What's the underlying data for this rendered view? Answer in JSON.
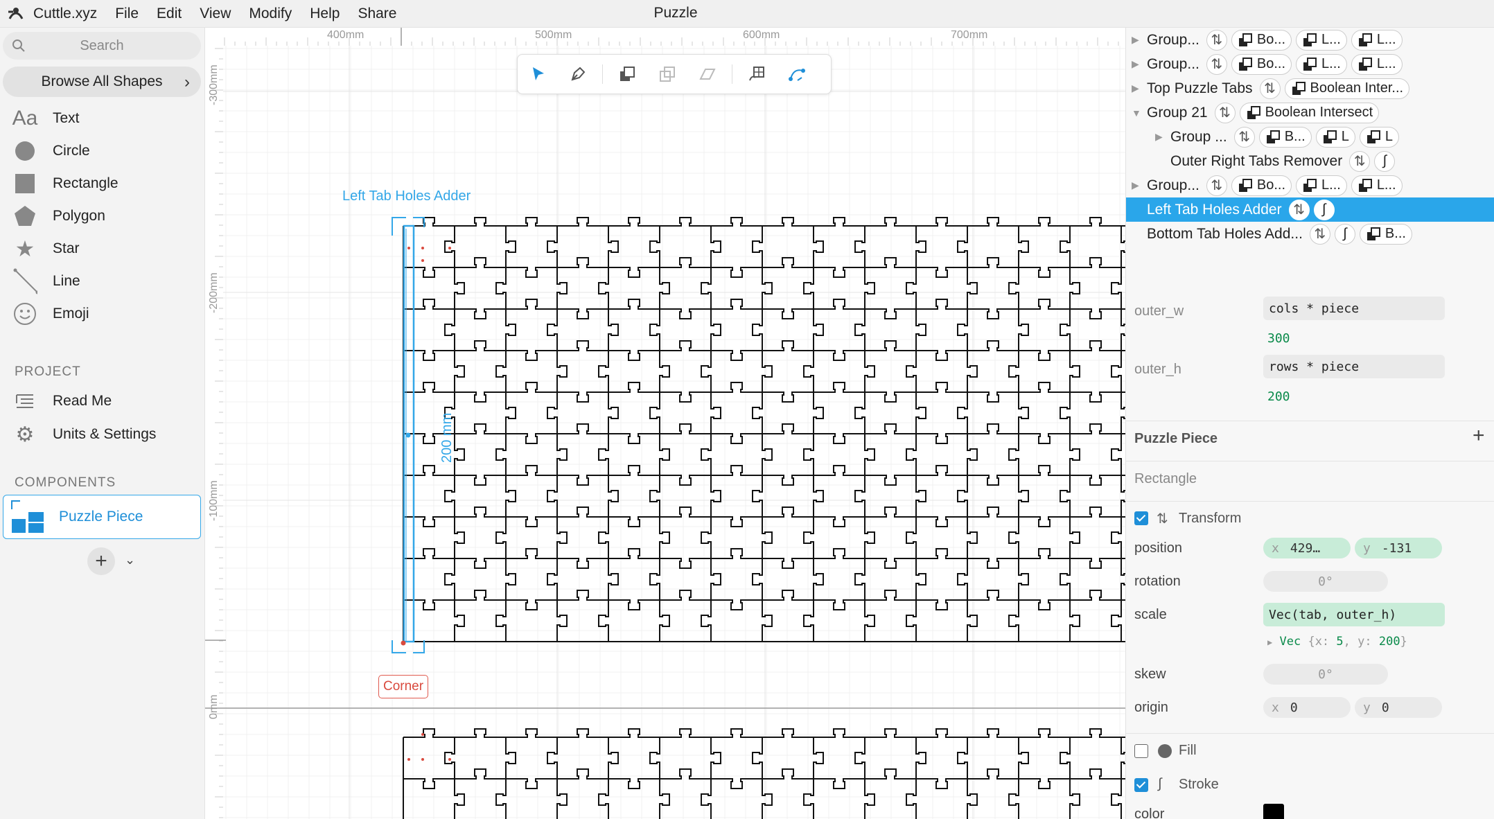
{
  "menubar": {
    "brand": "Cuttle.xyz",
    "items": [
      "File",
      "Edit",
      "View",
      "Modify",
      "Help",
      "Share"
    ],
    "doc_title": "Puzzle"
  },
  "sidebar": {
    "search_placeholder": "Search",
    "browse_label": "Browse All Shapes",
    "shapes": [
      {
        "label": "Text",
        "icon": "text-icon"
      },
      {
        "label": "Circle",
        "icon": "circle-icon"
      },
      {
        "label": "Rectangle",
        "icon": "rectangle-icon"
      },
      {
        "label": "Polygon",
        "icon": "polygon-icon"
      },
      {
        "label": "Star",
        "icon": "star-icon"
      },
      {
        "label": "Line",
        "icon": "line-icon"
      },
      {
        "label": "Emoji",
        "icon": "emoji-icon"
      }
    ],
    "project_heading": "PROJECT",
    "project_items": [
      {
        "label": "Read Me",
        "icon": "read-me-icon"
      },
      {
        "label": "Units & Settings",
        "icon": "gear-icon"
      }
    ],
    "components_heading": "COMPONENTS",
    "components": [
      {
        "label": "Puzzle Piece"
      }
    ]
  },
  "canvas": {
    "ruler_top": [
      "400mm",
      "500mm",
      "600mm",
      "700mm"
    ],
    "ruler_left": [
      "-300mm",
      "-200mm",
      "-100mm",
      "0mm"
    ],
    "selection_label": "Left Tab Holes Adder",
    "dimension_label": "200 mm",
    "corner_label": "Corner",
    "toolbar": [
      "select-tool-icon",
      "pen-tool-icon",
      "bring-forward-icon",
      "send-backward-icon",
      "send-to-back-icon",
      "rivet-icon",
      "node-edit-icon"
    ],
    "accent": "#33a7e8"
  },
  "tree": {
    "rows": [
      {
        "name": "Group...",
        "pills": [
          "Bo...",
          "L...",
          "L..."
        ]
      },
      {
        "name": "Group...",
        "pills": [
          "Bo...",
          "L...",
          "L..."
        ]
      },
      {
        "name": "Top Puzzle Tabs",
        "pills": [
          "Boolean Inter..."
        ]
      },
      {
        "name": "Group 21",
        "pills": [
          "Boolean Intersect"
        ]
      },
      {
        "name": "Group ...",
        "pills": [
          "B...",
          "L",
          "L"
        ]
      },
      {
        "name": "Outer Right Tabs Remover",
        "pills": []
      },
      {
        "name": "Group...",
        "pills": [
          "Bo...",
          "L...",
          "L..."
        ]
      },
      {
        "name": "Left Tab Holes Adder",
        "pills": []
      },
      {
        "name": "Bottom Tab Holes Add...",
        "pills": [
          "B..."
        ]
      }
    ]
  },
  "props": {
    "outer_w": {
      "label": "outer_w",
      "expr": "cols * piece",
      "value": "300"
    },
    "outer_h": {
      "label": "outer_h",
      "expr": "rows * piece",
      "value": "200"
    },
    "component_title": "Puzzle Piece",
    "shape_name": "Rectangle",
    "transform_label": "Transform",
    "position_label": "position",
    "position_x": "429…",
    "position_y": "-131",
    "rotation_label": "rotation",
    "rotation_value": "0°",
    "scale_label": "scale",
    "scale_expr": "Vec(tab, outer_h)",
    "scale_result_head": "Vec",
    "scale_result_x_key": "{x:",
    "scale_result_x_val": "5",
    "scale_result_y_key": ", y:",
    "scale_result_y_val": "200",
    "scale_result_tail": "}",
    "skew_label": "skew",
    "skew_value": "0°",
    "origin_label": "origin",
    "origin_x": "0",
    "origin_y": "0",
    "axis_x": "x",
    "axis_y": "y",
    "fill_label": "Fill",
    "stroke_label": "Stroke",
    "color_label": "color"
  }
}
